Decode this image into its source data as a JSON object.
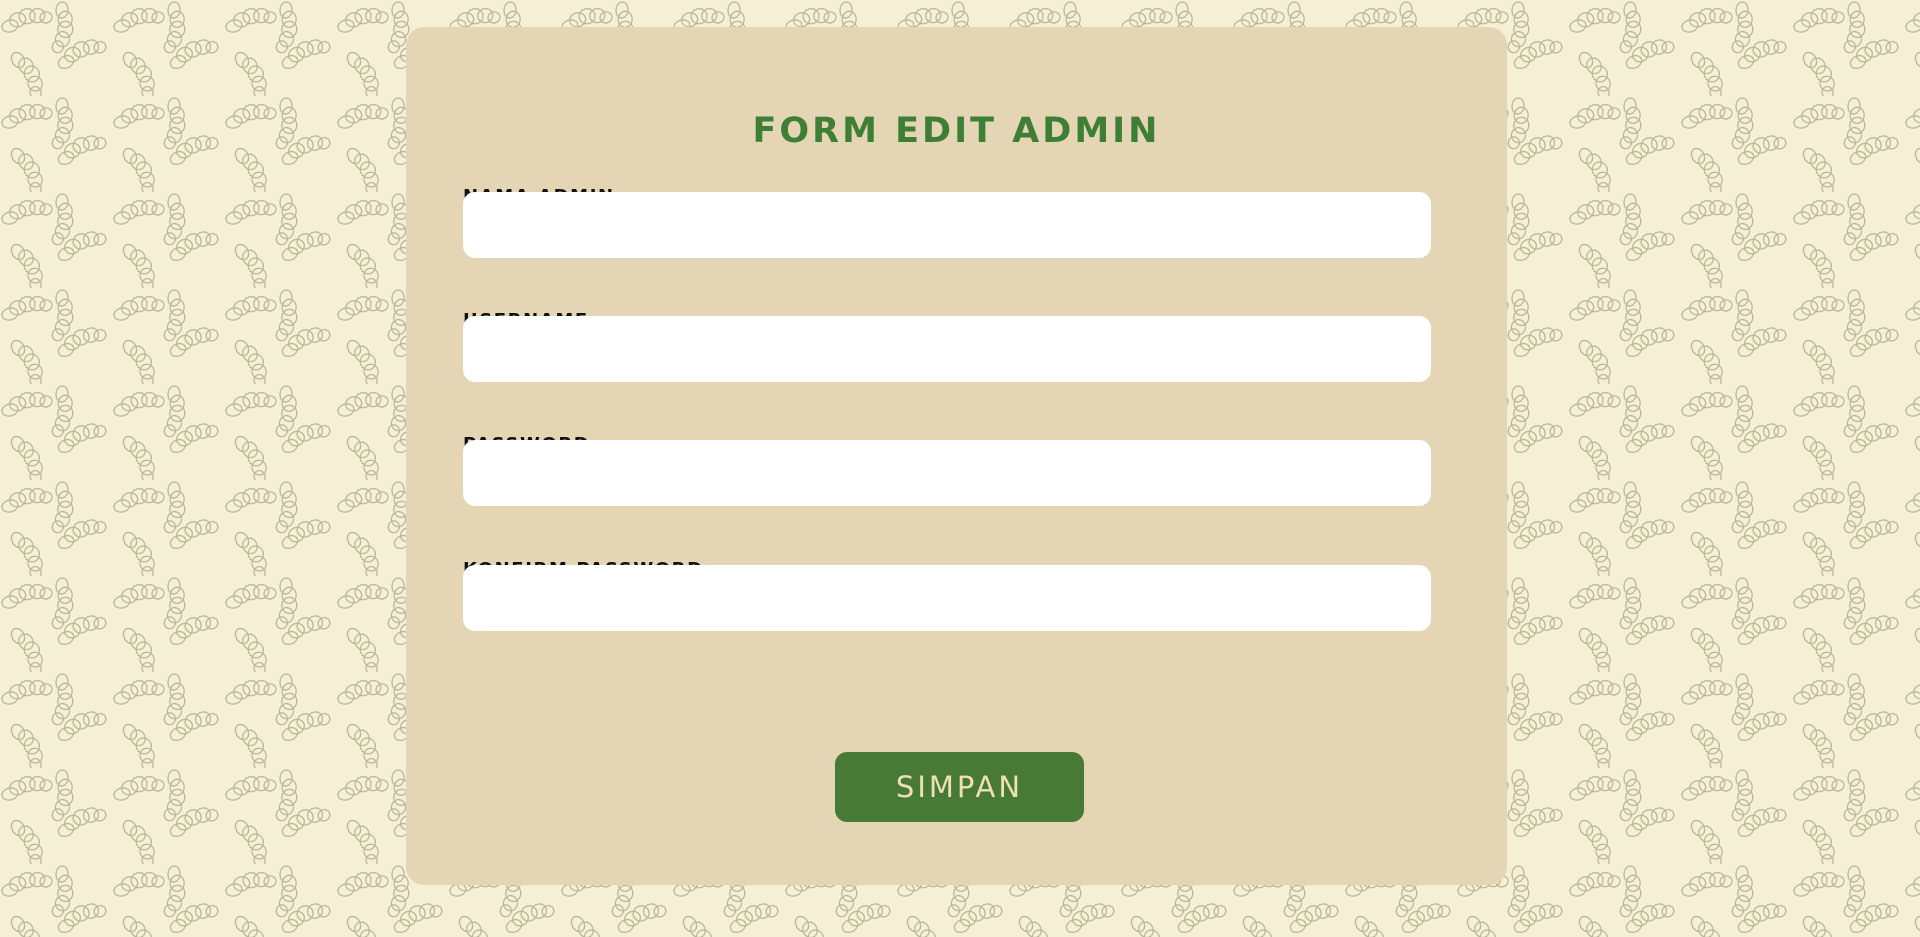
{
  "form": {
    "title": "FORM EDIT ADMIN",
    "fields": [
      {
        "label": "NAMA ADMIN",
        "value": "",
        "placeholder": ""
      },
      {
        "label": "USERNAME",
        "value": "",
        "placeholder": ""
      },
      {
        "label": "PASSWORD",
        "value": "",
        "placeholder": ""
      },
      {
        "label": "KONFIRM PASSWORD",
        "value": "",
        "placeholder": ""
      }
    ],
    "submit_label": "SIMPAN"
  },
  "colors": {
    "page_background": "#f5f0d5",
    "card_background": "#e4d6b5",
    "title": "#3e7e35",
    "button_background": "#477a35",
    "button_text": "#eedfb8",
    "pattern_stroke": "#bdb597"
  },
  "background_pattern_icon": "croissant-icon"
}
